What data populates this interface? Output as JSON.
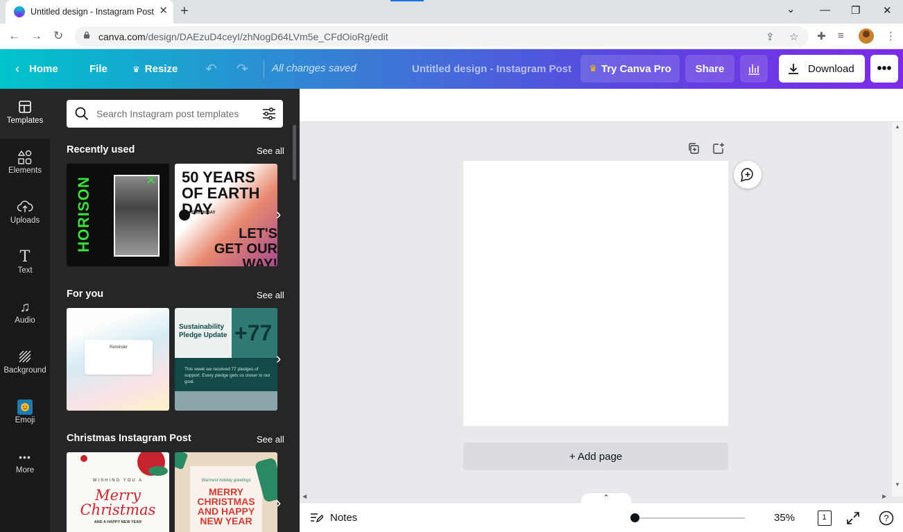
{
  "browser": {
    "tab_title": "Untitled design - Instagram Post",
    "url_host": "canva.com",
    "url_path": "/design/DAEzuD4ceyI/zhNogD64LVm5e_CFdOioRg/edit"
  },
  "header": {
    "home": "Home",
    "file": "File",
    "resize": "Resize",
    "saved_status": "All changes saved",
    "doc_title": "Untitled design - Instagram Post",
    "try_pro": "Try Canva Pro",
    "share": "Share",
    "download": "Download"
  },
  "rail": {
    "items": [
      {
        "label": "Templates"
      },
      {
        "label": "Elements"
      },
      {
        "label": "Uploads"
      },
      {
        "label": "Text"
      },
      {
        "label": "Audio"
      },
      {
        "label": "Background"
      },
      {
        "label": "Emoji"
      },
      {
        "label": "More"
      }
    ]
  },
  "panel": {
    "search_placeholder": "Search Instagram post templates",
    "see_all": "See all",
    "sections": [
      {
        "title": "Recently used",
        "thumbs": [
          {
            "text": "HORISON"
          },
          {
            "text": "50 YEARS OF EARTH DAY",
            "text2": "LET'S GET OUR WAY!",
            "text3": "EARTH DAY"
          }
        ]
      },
      {
        "title": "For you",
        "thumbs": [
          {
            "text": "Reminder"
          },
          {
            "text": "Sustainability Pledge Update",
            "text2": "+77",
            "text3": "This week we received 77 pledges of support. Every pledge gets us closer to our goal."
          }
        ]
      },
      {
        "title": "Christmas Instagram Post",
        "thumbs": [
          {
            "text": "WISHING YOU A",
            "text2": "Merry Christmas",
            "text3": "AND A HAPPY NEW YEAR"
          },
          {
            "text": "Warmest holiday greetings",
            "text2": "MERRY CHRISTMAS AND HAPPY NEW YEAR"
          }
        ]
      }
    ]
  },
  "editor": {
    "add_page": "+ Add page",
    "notes": "Notes",
    "zoom": "35%",
    "page_count": "1"
  },
  "colors": {
    "header_start": "#00c4cc",
    "header_end": "#7d2ae8",
    "rail_bg": "#18191b",
    "panel_bg": "#252627"
  }
}
